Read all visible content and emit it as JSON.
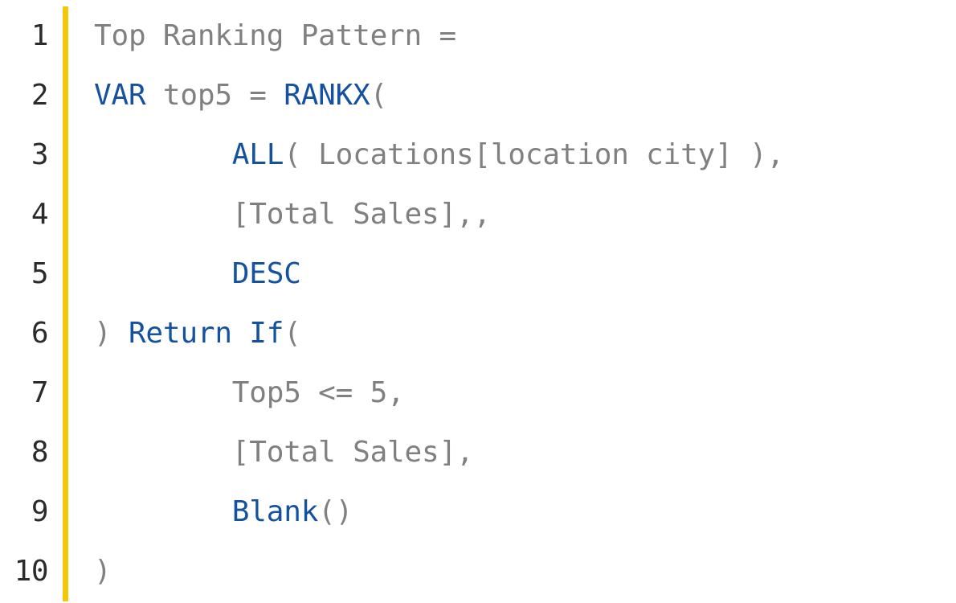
{
  "editor": {
    "accent_color": "#f5c70a",
    "lines": [
      {
        "num": "1",
        "tokens": [
          {
            "t": "Top Ranking Pattern = ",
            "c": "plain"
          }
        ]
      },
      {
        "num": "2",
        "tokens": [
          {
            "t": "VAR",
            "c": "keyword"
          },
          {
            "t": " top5 = ",
            "c": "plain"
          },
          {
            "t": "RANKX",
            "c": "func"
          },
          {
            "t": "(",
            "c": "plain"
          }
        ]
      },
      {
        "num": "3",
        "tokens": [
          {
            "t": "        ",
            "c": "plain"
          },
          {
            "t": "ALL",
            "c": "func"
          },
          {
            "t": "( Locations[location city] ),",
            "c": "plain"
          }
        ]
      },
      {
        "num": "4",
        "tokens": [
          {
            "t": "        [Total Sales],,",
            "c": "plain"
          }
        ]
      },
      {
        "num": "5",
        "tokens": [
          {
            "t": "        ",
            "c": "plain"
          },
          {
            "t": "DESC",
            "c": "keyword"
          }
        ]
      },
      {
        "num": "6",
        "tokens": [
          {
            "t": ") ",
            "c": "plain"
          },
          {
            "t": "Return",
            "c": "kw2"
          },
          {
            "t": " ",
            "c": "plain"
          },
          {
            "t": "If",
            "c": "func"
          },
          {
            "t": "(",
            "c": "plain"
          }
        ]
      },
      {
        "num": "7",
        "tokens": [
          {
            "t": "        Top5 <= 5,",
            "c": "plain"
          }
        ]
      },
      {
        "num": "8",
        "tokens": [
          {
            "t": "        [Total Sales],",
            "c": "plain"
          }
        ]
      },
      {
        "num": "9",
        "tokens": [
          {
            "t": "        ",
            "c": "plain"
          },
          {
            "t": "Blank",
            "c": "func"
          },
          {
            "t": "()",
            "c": "plain"
          }
        ]
      },
      {
        "num": "10",
        "tokens": [
          {
            "t": ")",
            "c": "plain"
          }
        ]
      }
    ]
  }
}
